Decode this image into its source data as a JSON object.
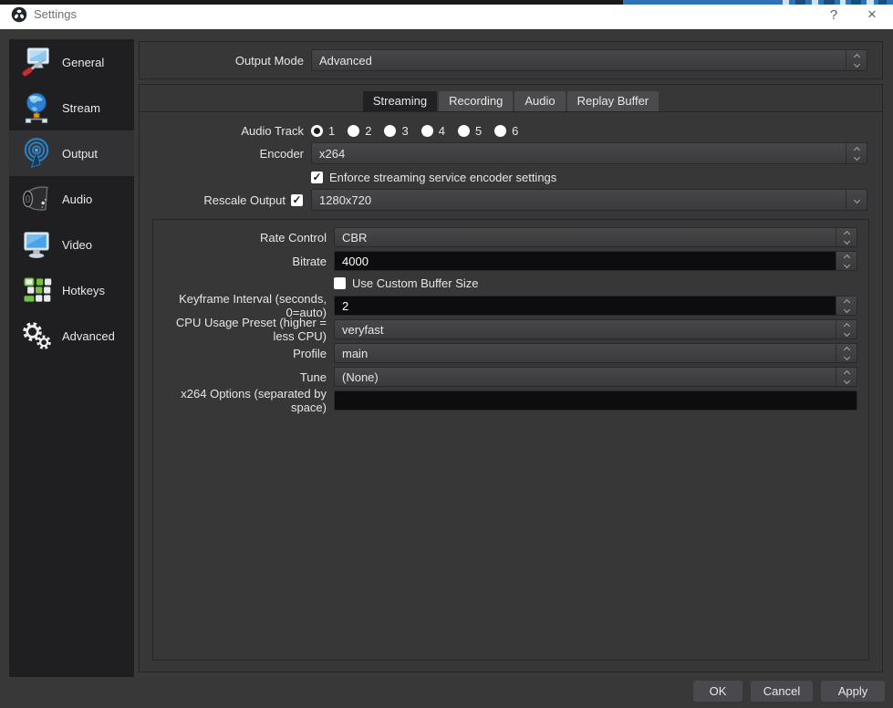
{
  "colors": {
    "titlebar_bg": "#ffffff",
    "window_bg": "#383838",
    "sidebar_bg": "#1f1f21",
    "sidebar_selected_bg": "#323234",
    "panel_border": "#252525",
    "tab_active_bg": "#212123",
    "tab_inactive_bg": "#4b4b4e",
    "field_dark_bg": "#0d0d0f",
    "button_bg": "#4a4a4e",
    "background_window_strip": "#2e72b8"
  },
  "titlebar": {
    "title": "Settings",
    "help": "?",
    "close": "×"
  },
  "sidebar": {
    "selected": "Output",
    "items": [
      {
        "label": "General",
        "icon": "general-computer-icon"
      },
      {
        "label": "Stream",
        "icon": "stream-globe-icon"
      },
      {
        "label": "Output",
        "icon": "output-broadcast-icon"
      },
      {
        "label": "Audio",
        "icon": "audio-speaker-icon"
      },
      {
        "label": "Video",
        "icon": "video-monitor-icon"
      },
      {
        "label": "Hotkeys",
        "icon": "hotkeys-keyboard-icon"
      },
      {
        "label": "Advanced",
        "icon": "advanced-gears-icon"
      }
    ]
  },
  "output_mode": {
    "label": "Output Mode",
    "value": "Advanced"
  },
  "tabs": [
    {
      "label": "Streaming",
      "active": true
    },
    {
      "label": "Recording",
      "active": false
    },
    {
      "label": "Audio",
      "active": false
    },
    {
      "label": "Replay Buffer",
      "active": false
    }
  ],
  "streaming": {
    "audio_track": {
      "label": "Audio Track",
      "options": [
        "1",
        "2",
        "3",
        "4",
        "5",
        "6"
      ],
      "selected": "1"
    },
    "encoder": {
      "label": "Encoder",
      "value": "x264"
    },
    "enforce_checkbox": {
      "label": "Enforce streaming service encoder settings",
      "checked": true
    },
    "rescale_output": {
      "label": "Rescale Output",
      "checked": true,
      "value": "1280x720"
    },
    "encoder_settings": {
      "rate_control": {
        "label": "Rate Control",
        "value": "CBR"
      },
      "bitrate": {
        "label": "Bitrate",
        "value": "4000"
      },
      "use_custom_buffer_size": {
        "label": "Use Custom Buffer Size",
        "checked": false
      },
      "keyframe_interval": {
        "label": "Keyframe Interval (seconds, 0=auto)",
        "value": "2"
      },
      "cpu_usage_preset": {
        "label": "CPU Usage Preset (higher = less CPU)",
        "value": "veryfast"
      },
      "profile": {
        "label": "Profile",
        "value": "main"
      },
      "tune": {
        "label": "Tune",
        "value": "(None)"
      },
      "x264_options": {
        "label": "x264 Options (separated by space)",
        "value": ""
      }
    }
  },
  "dialog_buttons": {
    "ok": "OK",
    "cancel": "Cancel",
    "apply": "Apply"
  }
}
